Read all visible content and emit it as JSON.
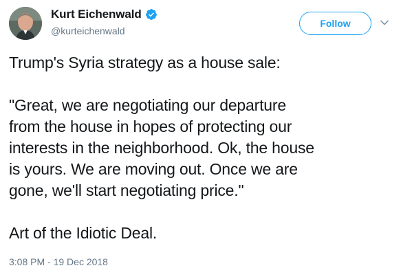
{
  "author": {
    "display_name": "Kurt Eichenwald",
    "handle": "@kurteichenwald",
    "verified": true,
    "verified_color": "#1da1f2"
  },
  "actions": {
    "follow_label": "Follow"
  },
  "tweet": {
    "paragraphs": [
      "Trump's Syria strategy as a house sale:",
      "\"Great, we are negotiating our departure\nfrom the house in hopes of protecting our\ninterests in the neighborhood. Ok, the house\nis yours. We are moving out. Once we are\ngone, we'll start negotiating price.\"",
      "Art of the Idiotic Deal."
    ],
    "timestamp": "3:08 PM - 19 Dec 2018"
  },
  "icons": {
    "verified": "verified-badge-icon",
    "more": "chevron-down-icon"
  }
}
